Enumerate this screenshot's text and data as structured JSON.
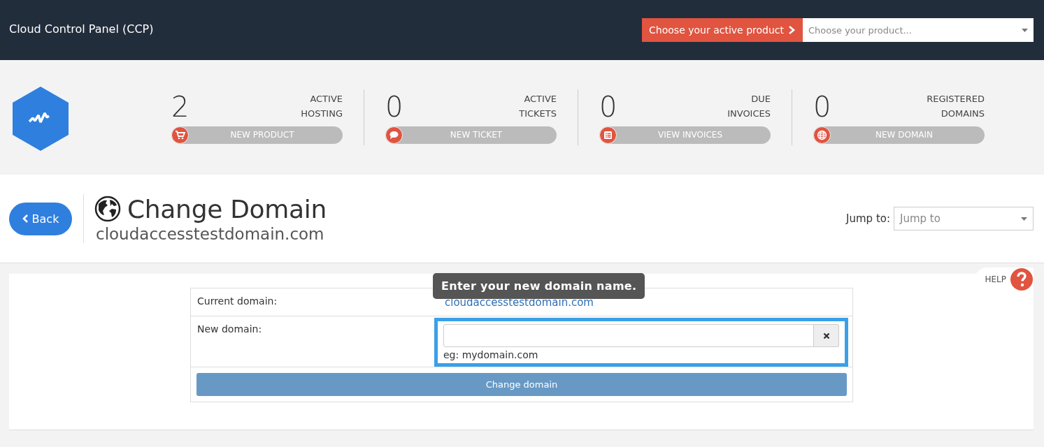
{
  "topbar": {
    "title": "Cloud Control Panel (CCP)",
    "product_button": "Choose your active product",
    "product_select": {
      "placeholder": "Choose your product..."
    }
  },
  "stats": [
    {
      "count": "2",
      "label": [
        "ACTIVE",
        "HOSTING"
      ],
      "action": "NEW PRODUCT"
    },
    {
      "count": "0",
      "label": [
        "ACTIVE",
        "TICKETS"
      ],
      "action": "NEW TICKET"
    },
    {
      "count": "0",
      "label": [
        "DUE",
        "INVOICES"
      ],
      "action": "VIEW INVOICES"
    },
    {
      "count": "0",
      "label": [
        "REGISTERED",
        "DOMAINS"
      ],
      "action": "NEW DOMAIN"
    }
  ],
  "page": {
    "back": "Back",
    "title": "Change Domain",
    "subtitle": "cloudaccesstestdomain.com",
    "jump_label": "Jump to:",
    "jump_select": {
      "placeholder": "Jump to"
    }
  },
  "help": "HELP",
  "form": {
    "tooltip": "Enter your new domain name.",
    "current_label": "Current domain:",
    "current_value": "cloudaccesstestdomain.com",
    "new_label": "New domain:",
    "new_hint": "eg: mydomain.com",
    "submit": "Change domain"
  }
}
